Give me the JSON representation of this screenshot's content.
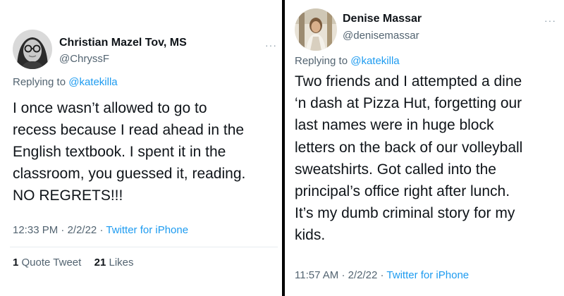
{
  "tweets": [
    {
      "display_name": "Christian Mazel Tov, MS",
      "handle": "@ChryssF",
      "replying_prefix": "Replying to",
      "replying_to": "@katekilla",
      "text_lines": [
        "I once wasn’t allowed to go to",
        "recess because I read ahead in the",
        "English textbook. I spent it in the",
        "classroom, you guessed it, reading.",
        "NO REGRETS!!!"
      ],
      "time": "12:33 PM",
      "date": "2/2/22",
      "separator": "·",
      "source": "Twitter for iPhone",
      "quote_tweets_count": "1",
      "quote_tweets_label": "Quote Tweet",
      "likes_count": "21",
      "likes_label": "Likes",
      "more_icon": "more-horizontal-icon",
      "more_glyph": "···"
    },
    {
      "display_name": "Denise Massar",
      "handle": "@denisemassar",
      "replying_prefix": "Replying to",
      "replying_to": "@katekilla",
      "text_lines": [
        "Two friends and I attempted a dine",
        "‘n dash at Pizza Hut, forgetting our",
        "last names were in huge block",
        "letters on the back of our volleyball",
        "sweatshirts. Got called into the",
        "principal’s office right after lunch.",
        "It’s my dumb criminal story for my",
        "kids."
      ],
      "time": "11:57 AM",
      "date": "2/2/22",
      "separator": "·",
      "source": "Twitter for iPhone",
      "more_icon": "more-horizontal-icon",
      "more_glyph": "···"
    }
  ],
  "colors": {
    "text": "#0f1419",
    "secondary": "#536471",
    "link": "#1d9bf0",
    "divider": "#000000"
  }
}
